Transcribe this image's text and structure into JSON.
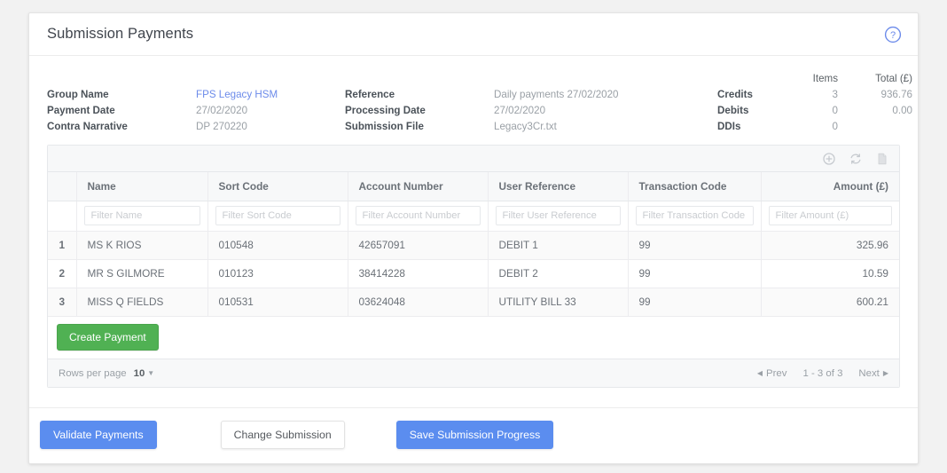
{
  "header": {
    "title": "Submission Payments",
    "help_icon": "help-circle-icon"
  },
  "summary": {
    "labels": {
      "group_name": "Group Name",
      "payment_date": "Payment Date",
      "contra_narrative": "Contra Narrative",
      "reference": "Reference",
      "processing_date": "Processing Date",
      "submission_file": "Submission File",
      "credits": "Credits",
      "debits": "Debits",
      "ddis": "DDIs"
    },
    "values": {
      "group_name": "FPS Legacy HSM",
      "payment_date": "27/02/2020",
      "contra_narrative": "DP 270220",
      "reference": "Daily payments 27/02/2020",
      "processing_date": "27/02/2020",
      "submission_file": "Legacy3Cr.txt"
    },
    "totals_headers": {
      "items": "Items",
      "total": "Total (£)"
    },
    "totals": {
      "credits_items": "3",
      "credits_total": "936.76",
      "debits_items": "0",
      "debits_total": "0.00",
      "ddis_items": "0"
    },
    "link_color": "#6c8bea"
  },
  "table": {
    "toolbar_icons": [
      "add-circle-icon",
      "refresh-icon",
      "file-icon"
    ],
    "columns": [
      "Name",
      "Sort Code",
      "Account Number",
      "User Reference",
      "Transaction Code",
      "Amount (£)"
    ],
    "filters": [
      "Filter Name",
      "Filter Sort Code",
      "Filter Account Number",
      "Filter User Reference",
      "Filter Transaction Code",
      "Filter Amount (£)"
    ],
    "rows": [
      {
        "n": "1",
        "name": "MS K RIOS",
        "sort_code": "010548",
        "account": "42657091",
        "user_ref": "DEBIT 1",
        "tx_code": "99",
        "amount": "325.96"
      },
      {
        "n": "2",
        "name": "MR S GILMORE",
        "sort_code": "010123",
        "account": "38414228",
        "user_ref": "DEBIT 2",
        "tx_code": "99",
        "amount": "10.59"
      },
      {
        "n": "3",
        "name": "MISS Q FIELDS",
        "sort_code": "010531",
        "account": "03624048",
        "user_ref": "UTILITY BILL 33",
        "tx_code": "99",
        "amount": "600.21"
      }
    ],
    "create_payment_label": "Create Payment",
    "create_payment_color": "#50b153"
  },
  "pagination": {
    "rows_per_page_label": "Rows per page",
    "rows_per_page_value": "10",
    "prev_label": "Prev",
    "range_label": "1 - 3 of 3",
    "next_label": "Next"
  },
  "footer": {
    "validate_label": "Validate Payments",
    "change_label": "Change Submission",
    "save_label": "Save Submission Progress",
    "primary_color": "#5b8def"
  }
}
